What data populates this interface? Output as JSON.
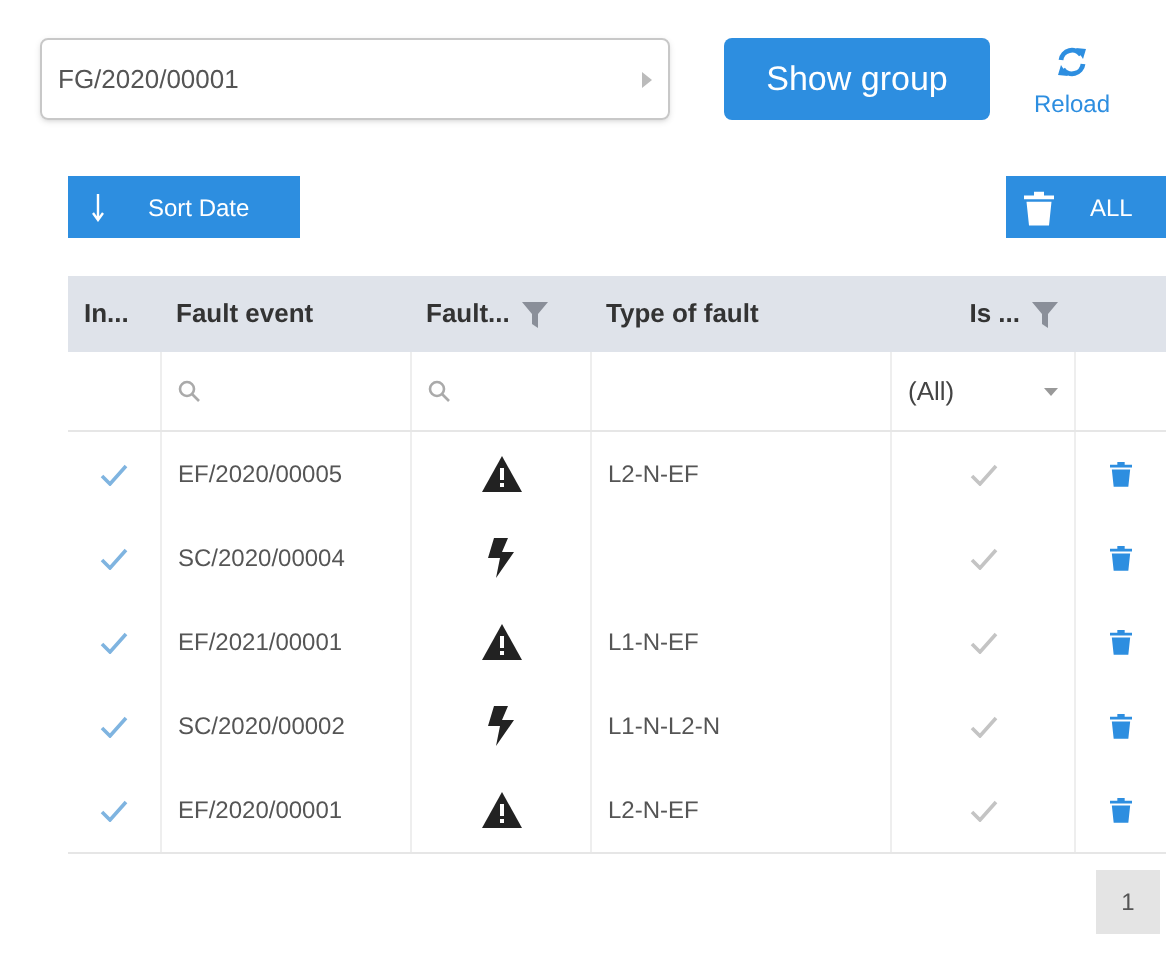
{
  "group_select": {
    "value": "FG/2020/00001"
  },
  "show_group_button": "Show group",
  "reload_button": "Reload",
  "sort_button": "Sort Date",
  "delete_all_button": "ALL",
  "table": {
    "columns": [
      {
        "label": "In...",
        "filter": false
      },
      {
        "label": "Fault event",
        "filter": false
      },
      {
        "label": "Fault...",
        "filter": true
      },
      {
        "label": "Type of fault",
        "filter": false
      },
      {
        "label": "Is ...",
        "filter": true
      }
    ],
    "filter_row": {
      "is_filter_value": "(All)"
    },
    "rows": [
      {
        "included": true,
        "fault_event": "EF/2020/00005",
        "kind": "warning",
        "type_of_fault": "L2-N-EF",
        "is": true
      },
      {
        "included": true,
        "fault_event": "SC/2020/00004",
        "kind": "bolt",
        "is": true
      },
      {
        "included": true,
        "fault_event": "EF/2021/00001",
        "kind": "warning",
        "type_of_fault": "L1-N-EF",
        "is": true
      },
      {
        "included": true,
        "fault_event": "SC/2020/00002",
        "kind": "bolt",
        "type_of_fault": "L1-N-L2-N",
        "is": true
      },
      {
        "included": true,
        "fault_event": "EF/2020/00001",
        "kind": "warning",
        "type_of_fault": "L2-N-EF",
        "is": true
      }
    ]
  },
  "pager": [
    {
      "label": "1",
      "selected": true
    }
  ]
}
